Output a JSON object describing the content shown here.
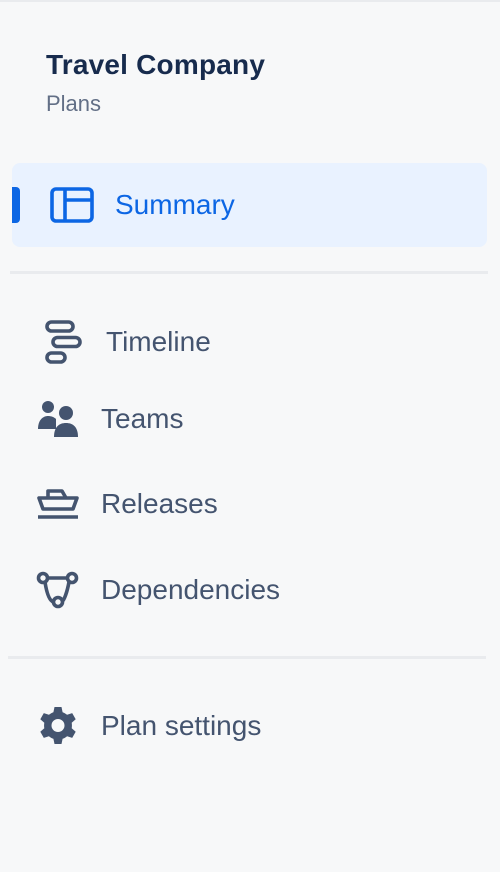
{
  "header": {
    "project_name": "Travel Company",
    "project_type": "Plans"
  },
  "nav": {
    "summary": {
      "label": "Summary",
      "icon": "summary-icon",
      "selected": true
    },
    "timeline": {
      "label": "Timeline",
      "icon": "timeline-icon"
    },
    "teams": {
      "label": "Teams",
      "icon": "teams-icon"
    },
    "releases": {
      "label": "Releases",
      "icon": "releases-icon"
    },
    "dependencies": {
      "label": "Dependencies",
      "icon": "dependencies-icon"
    },
    "plan_settings": {
      "label": "Plan settings",
      "icon": "gear-icon"
    }
  },
  "colors": {
    "accent": "#0c66e4",
    "selected_background": "#e9f2ff",
    "text": "#44546f",
    "heading": "#172b4d",
    "background": "#f7f8f9"
  }
}
